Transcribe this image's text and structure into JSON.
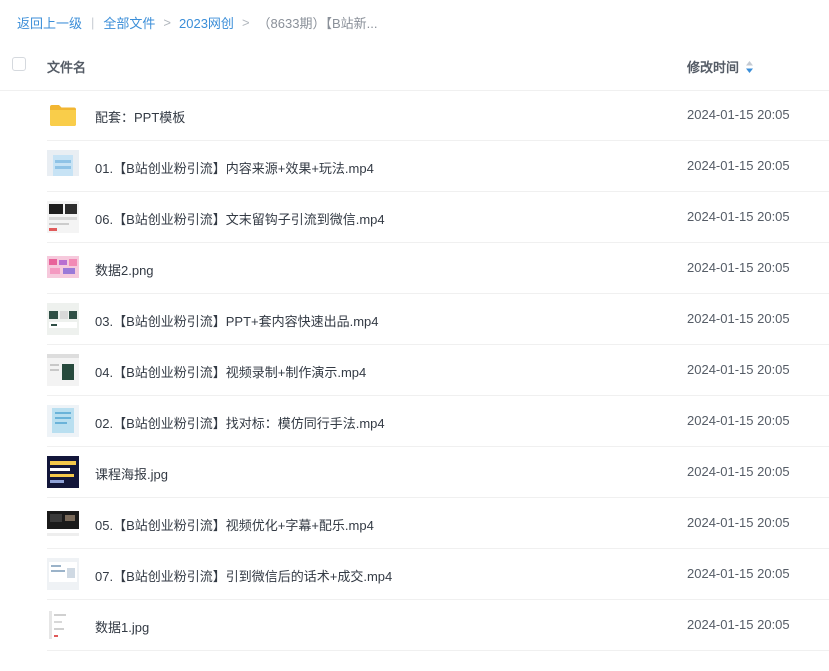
{
  "breadcrumb": {
    "back": "返回上一级",
    "root": "全部文件",
    "folder": "2023网创",
    "current": "（8633期）【B站新..."
  },
  "table": {
    "col_name": "文件名",
    "col_time": "修改时间",
    "sort_icon": "sort-desc-icon"
  },
  "files": [
    {
      "name": "配套：PPT模板",
      "time": "2024-01-15 20:05",
      "icon": "folder-icon"
    },
    {
      "name": "01.【B站创业粉引流】内容来源+效果+玩法.mp4",
      "time": "2024-01-15 20:05",
      "icon": "video-thumbnail"
    },
    {
      "name": "06.【B站创业粉引流】文末留钩子引流到微信.mp4",
      "time": "2024-01-15 20:05",
      "icon": "video-thumbnail"
    },
    {
      "name": "数据2.png",
      "time": "2024-01-15 20:05",
      "icon": "image-thumbnail"
    },
    {
      "name": "03.【B站创业粉引流】PPT+套内容快速出品.mp4",
      "time": "2024-01-15 20:05",
      "icon": "video-thumbnail"
    },
    {
      "name": "04.【B站创业粉引流】视频录制+制作演示.mp4",
      "time": "2024-01-15 20:05",
      "icon": "video-thumbnail"
    },
    {
      "name": "02.【B站创业粉引流】找对标：模仿同行手法.mp4",
      "time": "2024-01-15 20:05",
      "icon": "video-thumbnail"
    },
    {
      "name": "课程海报.jpg",
      "time": "2024-01-15 20:05",
      "icon": "image-thumbnail"
    },
    {
      "name": "05.【B站创业粉引流】视频优化+字幕+配乐.mp4",
      "time": "2024-01-15 20:05",
      "icon": "video-thumbnail"
    },
    {
      "name": "07.【B站创业粉引流】引到微信后的话术+成交.mp4",
      "time": "2024-01-15 20:05",
      "icon": "video-thumbnail"
    },
    {
      "name": "数据1.jpg",
      "time": "2024-01-15 20:05",
      "icon": "image-thumbnail"
    }
  ],
  "colors": {
    "link": "#3b8ed8",
    "folder": "#f7c948",
    "sort_active": "#3b8ed8"
  }
}
